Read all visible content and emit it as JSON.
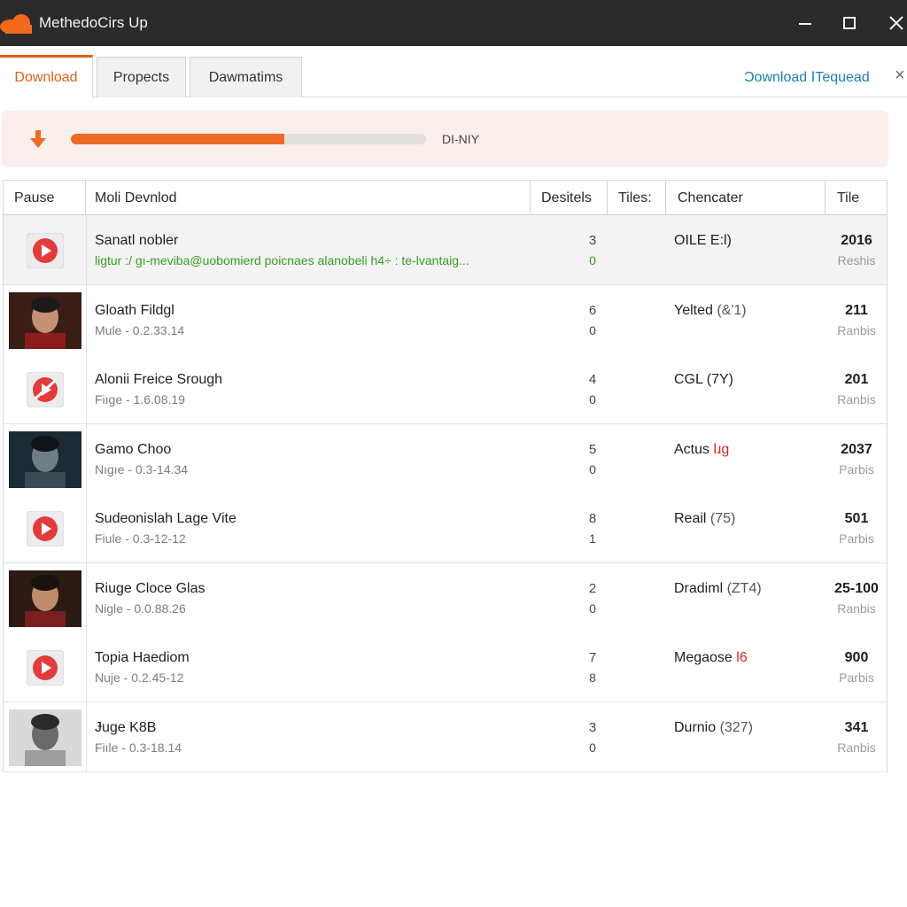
{
  "window": {
    "title": "MethedoCirs Up",
    "controls": {
      "minimize": "—",
      "maximize": "☐",
      "close": "✕"
    }
  },
  "tabs": {
    "items": [
      "Download",
      "Propects",
      "Dawmatims"
    ],
    "active": "Download",
    "right_link": "Ɔownload ⅠTequead",
    "close": "×"
  },
  "download_bar": {
    "progress_percent": 60,
    "status": "DI-NIY",
    "icon": "download-arrow-icon"
  },
  "table": {
    "columns": [
      "Pause",
      "Moli Devnlod",
      "Desitels",
      "Tiles:",
      "Chencater",
      "Tile"
    ],
    "rows": [
      {
        "thumb": "play-icon",
        "name": "Sanatl nobler",
        "meta": "ligtur :/ gı-meviba@uobomierd poicnaes alanobeli h4÷ : te-lvantaig...",
        "meta_green": true,
        "num_a": "3",
        "num_b": "0",
        "num_b_green": true,
        "char": "OILE E:l)",
        "char_paren": "",
        "char_red": "",
        "tile": "2016",
        "tile_sub": "Reshis",
        "highlight": true
      },
      {
        "thumb": "photo-man-cap",
        "name": "Gloath Fildgl",
        "meta": "Mule - 0.2.33.14",
        "meta_green": false,
        "num_a": "6",
        "num_b": "0",
        "num_b_green": false,
        "char": "Yelted ",
        "char_paren": "(&'1)",
        "char_red": "",
        "tile": "211",
        "tile_sub": "Ranbis",
        "highlight": false
      },
      {
        "thumb": "play-icon-slash",
        "name": "Alonii Freice Srough",
        "meta": "Fiıge - 1.6.08.19",
        "meta_green": false,
        "num_a": "4",
        "num_b": "0",
        "num_b_green": false,
        "char": "CGL (7Y)",
        "char_paren": "",
        "char_red": "",
        "tile": "201",
        "tile_sub": "Ranbis",
        "highlight": false
      },
      {
        "thumb": "photo-hooded",
        "name": "Gamo Choo",
        "meta": "Nıgıe - 0.3-14.34",
        "meta_green": false,
        "num_a": "5",
        "num_b": "0",
        "num_b_green": false,
        "char": "Actus ",
        "char_paren": "",
        "char_red": "lɹg",
        "tile": "2037",
        "tile_sub": "Parbis",
        "highlight": false
      },
      {
        "thumb": "play-icon",
        "name": "Sudeonislah Lage Vite",
        "meta": "Fiule - 0.3-12-12",
        "meta_green": false,
        "num_a": "8",
        "num_b": "1",
        "num_b_green": false,
        "char": "Reail ",
        "char_paren": "(75)",
        "char_red": "",
        "tile": "501",
        "tile_sub": "Parbis",
        "highlight": false
      },
      {
        "thumb": "photo-young-man",
        "name": "Riuge Cloce Glas",
        "meta": "Nigle - 0.0.88.26",
        "meta_green": false,
        "num_a": "2",
        "num_b": "0",
        "num_b_green": false,
        "char": "Dradiml ",
        "char_paren": "(ΖΤ4)",
        "char_red": "",
        "tile": "25-100",
        "tile_sub": "Ranbis",
        "highlight": false
      },
      {
        "thumb": "play-icon",
        "name": "Topia Haediom",
        "meta": "Nuje - 0.2.45-12",
        "meta_green": false,
        "num_a": "7",
        "num_b": "8",
        "num_b_green": false,
        "char": "Megaose ",
        "char_paren": "",
        "char_red": "l6",
        "tile": "900",
        "tile_sub": "Parbis",
        "highlight": false
      },
      {
        "thumb": "photo-couple",
        "name": "Ɉuge K8B",
        "meta": "Fiıle - 0.3-18.14",
        "meta_green": false,
        "num_a": "3",
        "num_b": "0",
        "num_b_green": false,
        "char": "Durnio ",
        "char_paren": "(327)",
        "char_red": "",
        "tile": "341",
        "tile_sub": "Ranbis",
        "highlight": false
      }
    ]
  },
  "colors": {
    "accent": "#ee6a25",
    "titlebar": "#2b2b2b",
    "link": "#1a7fb8",
    "green": "#3a9d23",
    "play_red": "#e23b3b"
  }
}
